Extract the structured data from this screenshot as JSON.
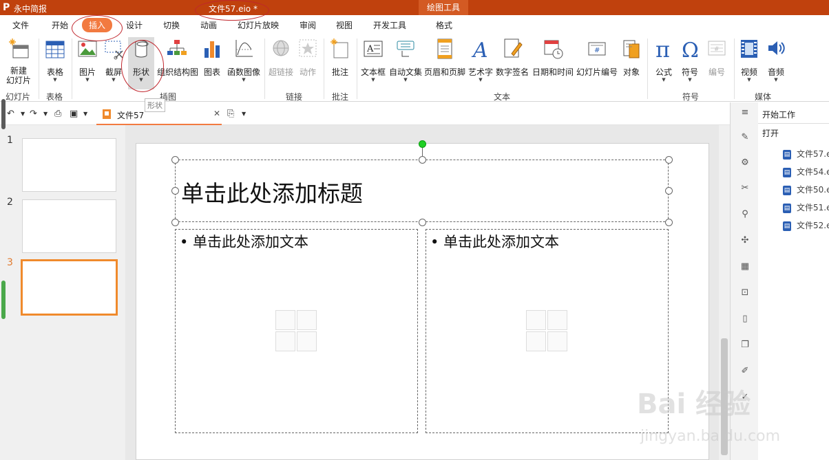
{
  "titlebar": {
    "logo": "P",
    "app_name": "永中简报",
    "document_title": "文件57.eio *",
    "context_tools": "绘图工具"
  },
  "ribbon_tabs": [
    "文件",
    "开始",
    "插入",
    "设计",
    "切换",
    "动画",
    "幻灯片放映",
    "审阅",
    "视图",
    "开发工具",
    "格式"
  ],
  "ribbon": {
    "new_slide": "新建\n幻灯片",
    "table": "表格",
    "picture": "图片",
    "screenshot": "截屏",
    "shape": "形状",
    "smartart": "组织结构图",
    "chart": "图表",
    "function": "函数图像",
    "hyperlink": "超链接",
    "action": "动作",
    "comment": "批注",
    "textbox": "文本框",
    "autotext": "自动文集",
    "header_footer": "页眉和页脚",
    "wordart": "艺术字",
    "signature": "数字签名",
    "datetime": "日期和时间",
    "slide_number": "幻灯片编号",
    "object": "对象",
    "formula": "公式",
    "symbol": "符号",
    "numbering": "编号",
    "video": "视频",
    "audio": "音频"
  },
  "groups": {
    "slides": "幻灯片",
    "table": "表格",
    "illustrations": "插图",
    "links": "链接",
    "comments": "批注",
    "text": "文本",
    "symbols": "符号",
    "media": "媒体"
  },
  "tooltip": "形状",
  "doc_tab": {
    "name": "文件57"
  },
  "slide_panel": {
    "numbers": [
      "1",
      "2",
      "3"
    ],
    "current": "3"
  },
  "slide": {
    "title_placeholder": "单击此处添加标题",
    "left_placeholder": "• 单击此处添加文本",
    "right_placeholder": "• 单击此处添加文本"
  },
  "task_panel": {
    "heading": "开始工作",
    "open_label": "打开",
    "recent_files": [
      "文件57.e",
      "文件54.e",
      "文件50.e",
      "文件51.e",
      "文件52.e"
    ]
  },
  "watermark": {
    "brand": "Bai 经验",
    "url": "jingyan.baidu.com"
  },
  "colors": {
    "titlebar": "#c0410d",
    "accent": "#f27a40",
    "annotation": "#c0262d",
    "selection_border": "#f08a2c"
  }
}
